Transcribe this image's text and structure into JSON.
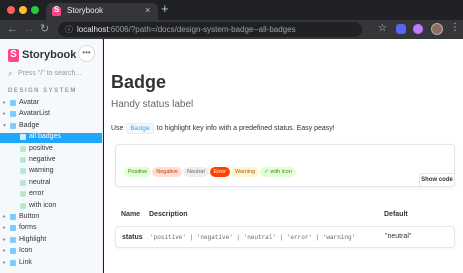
{
  "browser": {
    "tab_title": "Storybook",
    "tab_close": "×",
    "new_tab": "+",
    "url_host": "localhost",
    "url_rest": ":6006/?path=/docs/design-system-badge--all-badges"
  },
  "sidebar": {
    "logo_text": "Storybook",
    "menu_glyph": "•••",
    "search_placeholder": "Press \"/\" to search...",
    "section_label": "DESIGN SYSTEM",
    "items": [
      {
        "label": "Avatar",
        "kind": "component",
        "level": 0,
        "expanded": false
      },
      {
        "label": "AvatarList",
        "kind": "component",
        "level": 0,
        "expanded": false
      },
      {
        "label": "Badge",
        "kind": "component",
        "level": 0,
        "expanded": true
      },
      {
        "label": "all badges",
        "kind": "story",
        "level": 1,
        "selected": true
      },
      {
        "label": "positive",
        "kind": "story",
        "level": 1
      },
      {
        "label": "negative",
        "kind": "story",
        "level": 1
      },
      {
        "label": "warning",
        "kind": "story",
        "level": 1
      },
      {
        "label": "neutral",
        "kind": "story",
        "level": 1
      },
      {
        "label": "error",
        "kind": "story",
        "level": 1
      },
      {
        "label": "with icon",
        "kind": "story",
        "level": 1
      },
      {
        "label": "Button",
        "kind": "component",
        "level": 0,
        "expanded": false
      },
      {
        "label": "forms",
        "kind": "component",
        "level": 0,
        "expanded": false
      },
      {
        "label": "Highlight",
        "kind": "component",
        "level": 0,
        "expanded": false
      },
      {
        "label": "Icon",
        "kind": "component",
        "level": 0,
        "expanded": false
      },
      {
        "label": "Link",
        "kind": "component",
        "level": 0,
        "expanded": false
      }
    ]
  },
  "docs": {
    "title": "Badge",
    "subtitle": "Handy status label",
    "desc_before": "Use",
    "desc_code": "Badge",
    "desc_after": "to highlight key info with a predefined status. Easy peasy!",
    "badges": [
      {
        "label": "Positive",
        "status": "positive"
      },
      {
        "label": "Negative",
        "status": "negative"
      },
      {
        "label": "Neutral",
        "status": "neutral"
      },
      {
        "label": "Error",
        "status": "error"
      },
      {
        "label": "Warning",
        "status": "warning"
      },
      {
        "label": "with icon",
        "status": "positive",
        "icon": "check-circle-icon"
      }
    ],
    "show_code_label": "Show code",
    "props_headers": {
      "name": "Name",
      "description": "Description",
      "default": "Default"
    },
    "props_rows": [
      {
        "name": "status",
        "type": "'positive' | 'negative' | 'neutral' | 'error' | 'warning'",
        "default": "\"neutral\""
      }
    ]
  },
  "colors": {
    "accent": "#1ea7fd",
    "brand": "#ff4785"
  }
}
